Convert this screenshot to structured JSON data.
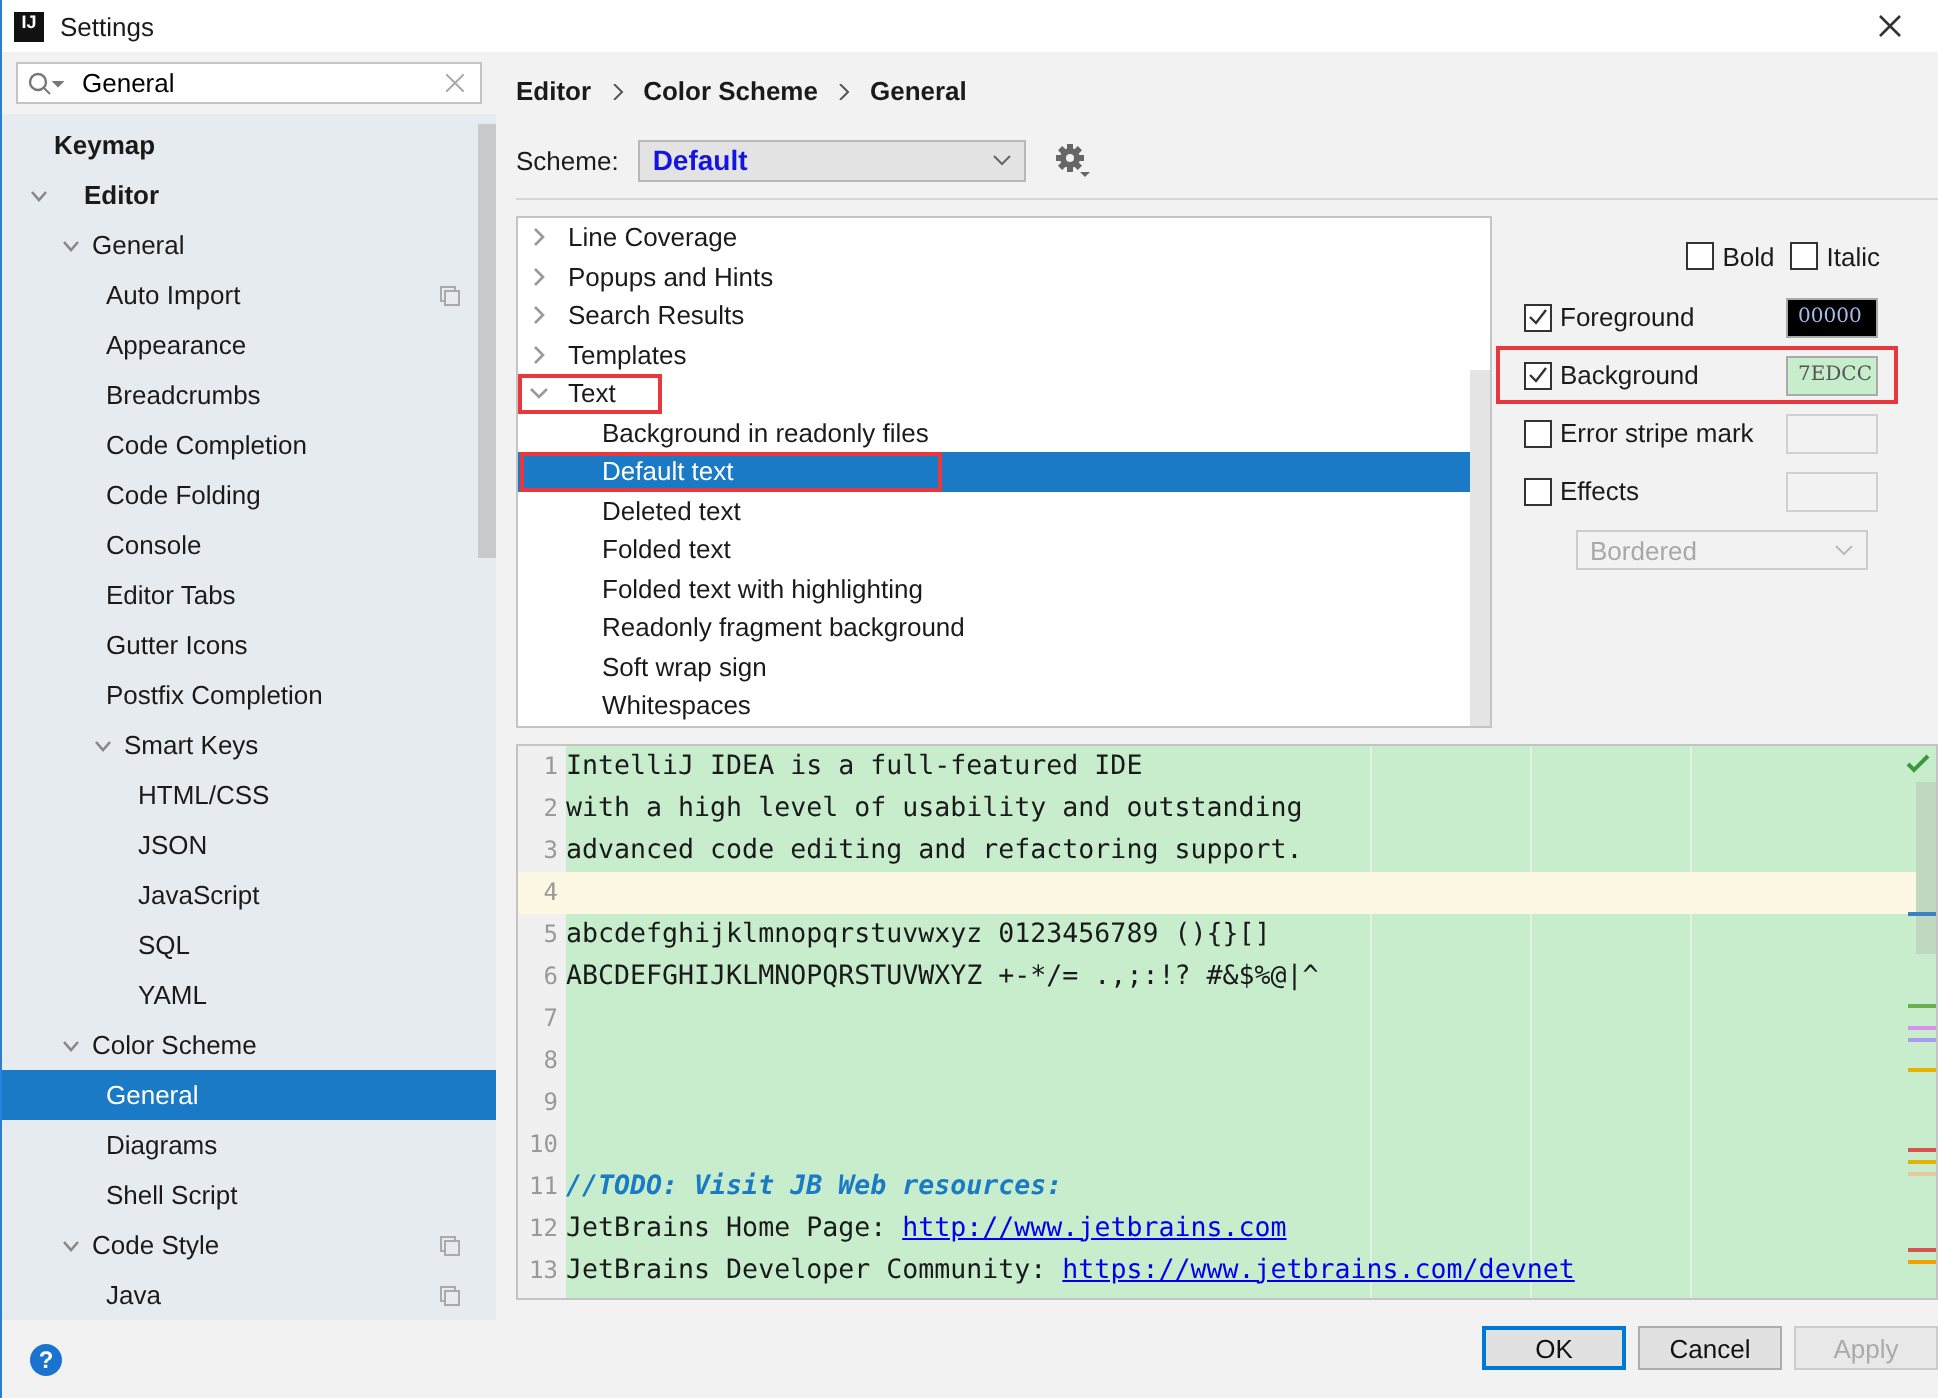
{
  "window": {
    "app_icon": "IJ",
    "title": "Settings"
  },
  "search": {
    "value": "General"
  },
  "sidebar": {
    "items": [
      {
        "label": "Keymap",
        "selected": false
      },
      {
        "label": "Editor",
        "selected": false,
        "expanded": true,
        "children": [
          {
            "label": "General",
            "selected": false,
            "expanded": true,
            "children": [
              {
                "label": "Auto Import",
                "selected": false,
                "copy": true
              },
              {
                "label": "Appearance",
                "selected": false
              },
              {
                "label": "Breadcrumbs",
                "selected": false
              },
              {
                "label": "Code Completion",
                "selected": false
              },
              {
                "label": "Code Folding",
                "selected": false
              },
              {
                "label": "Console",
                "selected": false
              },
              {
                "label": "Editor Tabs",
                "selected": false
              },
              {
                "label": "Gutter Icons",
                "selected": false
              },
              {
                "label": "Postfix Completion",
                "selected": false
              },
              {
                "label": "Smart Keys",
                "selected": false,
                "expanded": true,
                "children": [
                  {
                    "label": "HTML/CSS",
                    "selected": false
                  },
                  {
                    "label": "JSON",
                    "selected": false
                  },
                  {
                    "label": "JavaScript",
                    "selected": false
                  },
                  {
                    "label": "SQL",
                    "selected": false
                  },
                  {
                    "label": "YAML",
                    "selected": false
                  }
                ]
              }
            ]
          },
          {
            "label": "Color Scheme",
            "selected": false,
            "expanded": true,
            "children": [
              {
                "label": "General",
                "selected": true
              },
              {
                "label": "Diagrams",
                "selected": false
              },
              {
                "label": "Shell Script",
                "selected": false
              }
            ]
          },
          {
            "label": "Code Style",
            "selected": false,
            "expanded": true,
            "copy": true,
            "children": [
              {
                "label": "Java",
                "selected": false,
                "copy": true
              }
            ]
          }
        ]
      }
    ]
  },
  "breadcrumb": [
    "Editor",
    "Color Scheme",
    "General"
  ],
  "scheme": {
    "label": "Scheme:",
    "value": "Default"
  },
  "options_tree": [
    {
      "label": "Line Coverage",
      "expanded": false,
      "selected": false,
      "highlighted": false
    },
    {
      "label": "Popups and Hints",
      "expanded": false,
      "selected": false,
      "highlighted": false
    },
    {
      "label": "Search Results",
      "expanded": false,
      "selected": false,
      "highlighted": false
    },
    {
      "label": "Templates",
      "expanded": false,
      "selected": false,
      "highlighted": false
    },
    {
      "label": "Text",
      "expanded": true,
      "selected": false,
      "highlighted": true,
      "children": [
        {
          "label": "Background in readonly files",
          "selected": false,
          "highlighted": false
        },
        {
          "label": "Default text",
          "selected": true,
          "highlighted": true
        },
        {
          "label": "Deleted text",
          "selected": false,
          "highlighted": false
        },
        {
          "label": "Folded text",
          "selected": false,
          "highlighted": false
        },
        {
          "label": "Folded text with highlighting",
          "selected": false,
          "highlighted": false
        },
        {
          "label": "Readonly fragment background",
          "selected": false,
          "highlighted": false
        },
        {
          "label": "Soft wrap sign",
          "selected": false,
          "highlighted": false
        },
        {
          "label": "Whitespaces",
          "selected": false,
          "highlighted": false
        }
      ]
    }
  ],
  "font_style": [
    {
      "label": "Bold",
      "checked": false
    },
    {
      "label": "Italic",
      "checked": false
    }
  ],
  "attributes": [
    {
      "label": "Foreground",
      "checked": true,
      "highlighted": false,
      "value": "00000",
      "color": "#000000"
    },
    {
      "label": "Background",
      "checked": true,
      "highlighted": true,
      "value": "7EDCC",
      "color": "#c7edcc"
    },
    {
      "label": "Error stripe mark",
      "checked": false,
      "highlighted": false
    },
    {
      "label": "Effects",
      "checked": false,
      "highlighted": false
    }
  ],
  "effect_type": {
    "value": "Bordered",
    "disabled": true
  },
  "preview": {
    "lines": [
      {
        "number": "1",
        "current": false,
        "segments": [
          {
            "text": "IntelliJ IDEA is a full-featured IDE",
            "kind": "plain"
          }
        ]
      },
      {
        "number": "2",
        "current": false,
        "segments": [
          {
            "text": "with a high level of usability and outstanding",
            "kind": "plain"
          }
        ]
      },
      {
        "number": "3",
        "current": false,
        "segments": [
          {
            "text": "advanced code editing and refactoring support.",
            "kind": "plain"
          }
        ]
      },
      {
        "number": "4",
        "current": true
      },
      {
        "number": "5",
        "current": false,
        "segments": [
          {
            "text": "abcdefghijklmnopqrstuvwxyz 0123456789 (){}[]",
            "kind": "plain"
          }
        ]
      },
      {
        "number": "6",
        "current": false,
        "segments": [
          {
            "text": "ABCDEFGHIJKLMNOPQRSTUVWXYZ +-*/= .,;:!? #&$%@|^",
            "kind": "plain"
          }
        ]
      },
      {
        "number": "7",
        "current": false
      },
      {
        "number": "8",
        "current": false
      },
      {
        "number": "9",
        "current": false
      },
      {
        "number": "10",
        "current": false
      },
      {
        "number": "11",
        "current": false,
        "segments": [
          {
            "text": "//TODO: Visit JB Web resources:",
            "kind": "todo"
          }
        ]
      },
      {
        "number": "12",
        "current": false,
        "segments": [
          {
            "text": "JetBrains Home Page: ",
            "kind": "plain"
          },
          {
            "text": "http://www.jetbrains.com",
            "kind": "link"
          }
        ]
      },
      {
        "number": "13",
        "current": false,
        "segments": [
          {
            "text": "JetBrains Developer Community: ",
            "kind": "plain"
          },
          {
            "text": "https://www.jetbrains.com/devnet",
            "kind": "link"
          }
        ]
      }
    ]
  },
  "help": "?",
  "buttons": [
    {
      "label": "OK",
      "kind": "default",
      "disabled": false
    },
    {
      "label": "Cancel",
      "kind": "normal",
      "disabled": false
    },
    {
      "label": "Apply",
      "kind": "normal",
      "disabled": true
    }
  ]
}
